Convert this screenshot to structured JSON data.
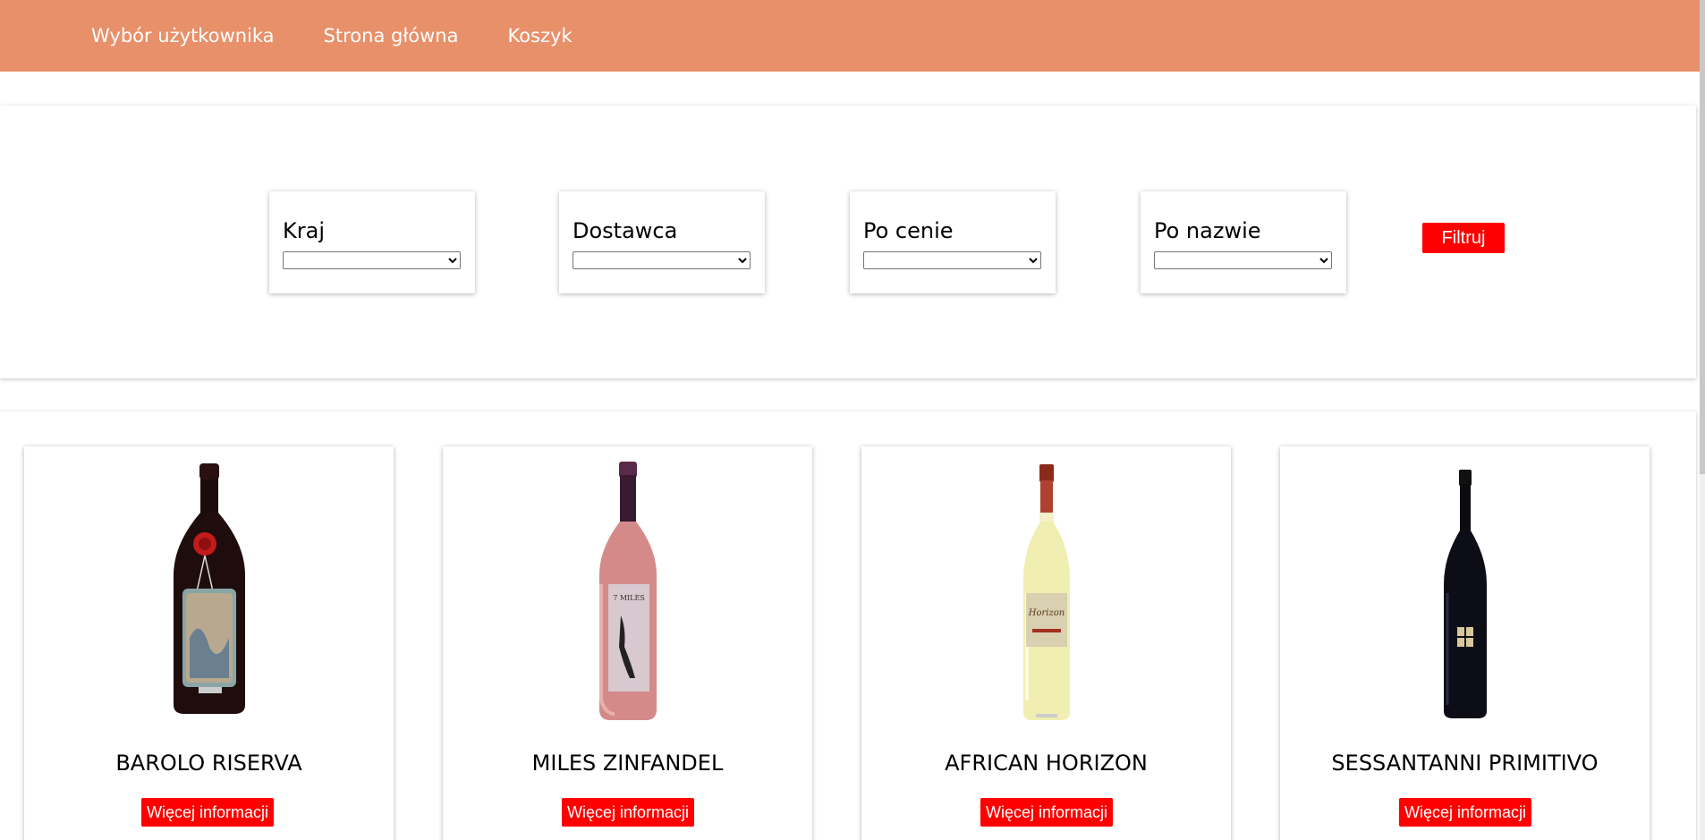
{
  "nav": {
    "items": [
      {
        "label": "Wybór użytkownika"
      },
      {
        "label": "Strona główna"
      },
      {
        "label": "Koszyk"
      }
    ],
    "background_color": "#e8906a"
  },
  "filters": {
    "fields": [
      {
        "label": "Kraj",
        "value": ""
      },
      {
        "label": "Dostawca",
        "value": ""
      },
      {
        "label": "Po cenie",
        "value": ""
      },
      {
        "label": "Po nazwie",
        "value": ""
      }
    ],
    "button_label": "Filtruj"
  },
  "products": [
    {
      "name": "BAROLO RISERVA",
      "button_label": "Więcej informacji",
      "bottle_icon": "dark-red-wine-bottle-with-seal"
    },
    {
      "name": "MILES ZINFANDEL",
      "button_label": "Więcej informacji",
      "bottle_icon": "rose-wine-bottle"
    },
    {
      "name": "AFRICAN HORIZON",
      "button_label": "Więcej informacji",
      "bottle_icon": "white-wine-bottle"
    },
    {
      "name": "SESSANTANNI PRIMITIVO",
      "button_label": "Więcej informacji",
      "bottle_icon": "black-wine-bottle"
    }
  ],
  "colors": {
    "accent": "#ff0000",
    "nav": "#e8906a"
  }
}
